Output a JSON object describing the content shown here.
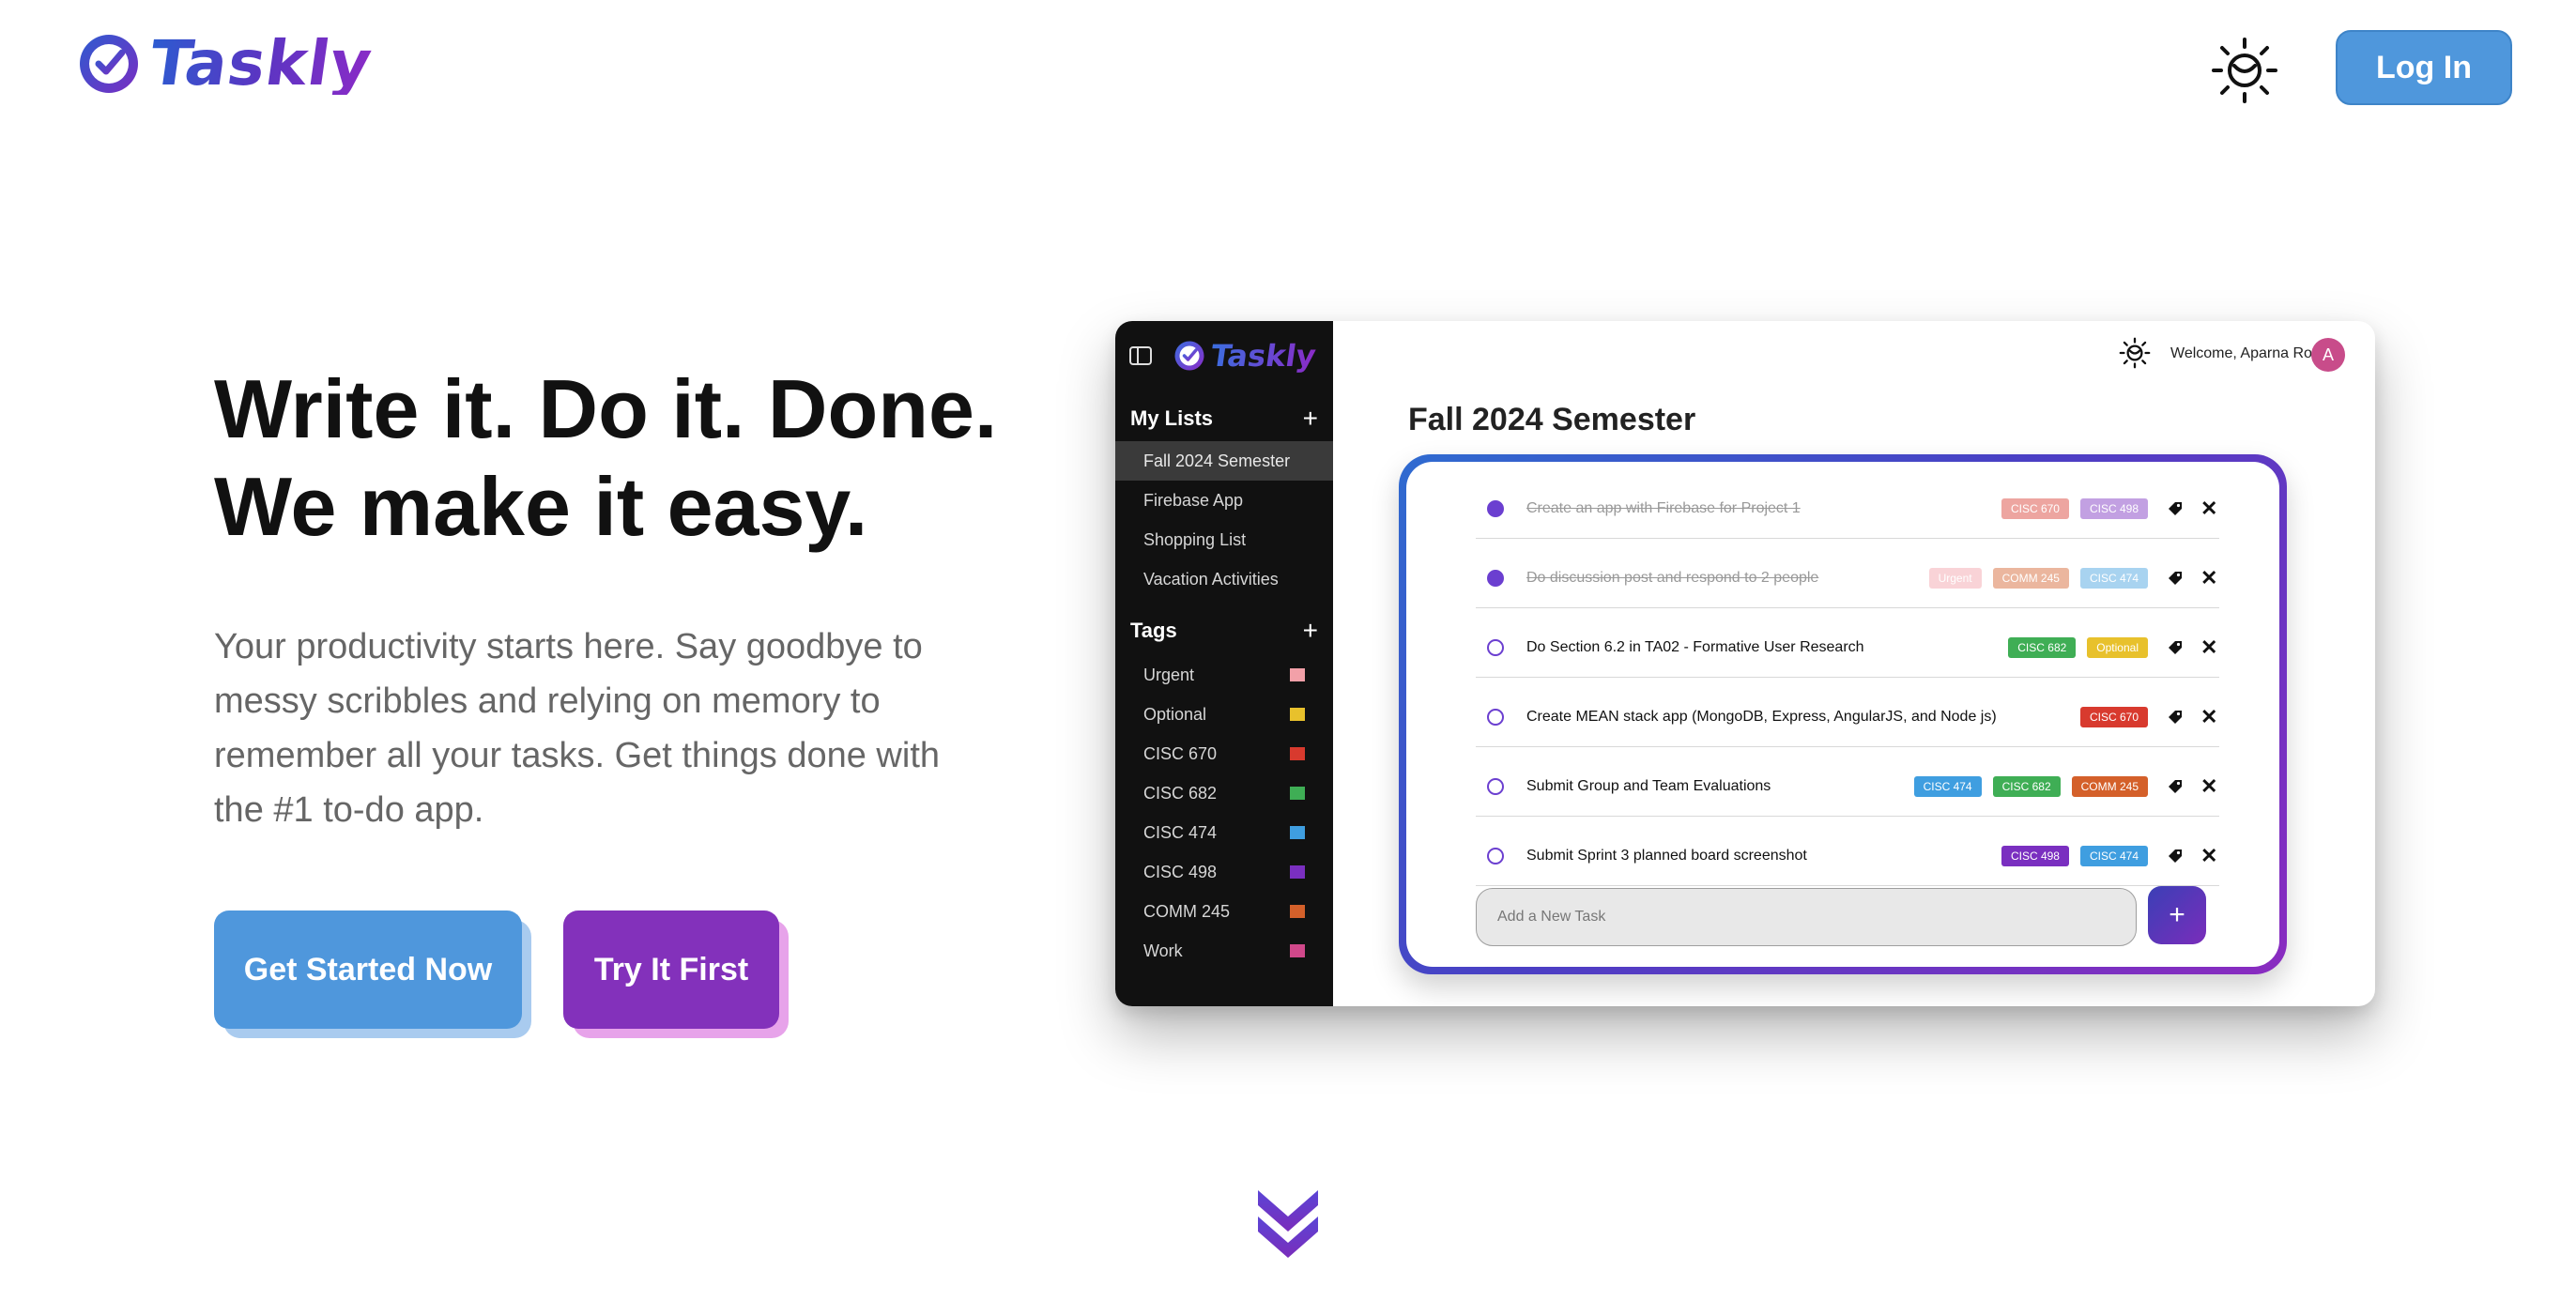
{
  "header": {
    "brand": "Taskly",
    "login_label": "Log In",
    "icons": {
      "logo": "check-circle-icon",
      "theme": "sun-icon"
    }
  },
  "hero": {
    "headline_line1": "Write it. Do it. Done.",
    "headline_line2": "We make it easy.",
    "subtext": "Your productivity starts here. Say goodbye to messy scribbles and relying on memory to remember all your tasks. Get things done with the #1 to-do app.",
    "cta_primary": "Get Started Now",
    "cta_secondary": "Try It First"
  },
  "colors": {
    "primary_blue": "#4f97dc",
    "accent_purple": "#8331bb",
    "brand_gradient": [
      "#2d5bd0",
      "#8a2bc7"
    ]
  },
  "mock": {
    "brand": "Taskly",
    "welcome": "Welcome, Aparna Roy",
    "avatar_initial": "A",
    "page_title": "Fall 2024 Semester",
    "my_lists_heading": "My Lists",
    "lists": [
      "Fall 2024 Semester",
      "Firebase App",
      "Shopping List",
      "Vacation Activities"
    ],
    "active_list": "Fall 2024 Semester",
    "tags_heading": "Tags",
    "tags": [
      {
        "name": "Urgent",
        "color": "#f2a0a8"
      },
      {
        "name": "Optional",
        "color": "#e8c12c"
      },
      {
        "name": "CISC 670",
        "color": "#d83a2e"
      },
      {
        "name": "CISC 682",
        "color": "#3fae55"
      },
      {
        "name": "CISC 474",
        "color": "#3f9ee0"
      },
      {
        "name": "CISC 498",
        "color": "#7a2fc0"
      },
      {
        "name": "COMM 245",
        "color": "#d4602a"
      },
      {
        "name": "Work",
        "color": "#d0488a"
      }
    ],
    "tasks": [
      {
        "text": "Create an app with Firebase for Project 1",
        "done": true,
        "tags": [
          "CISC 670",
          "CISC 498"
        ]
      },
      {
        "text": "Do discussion post and respond to 2 people",
        "done": true,
        "tags": [
          "Urgent",
          "COMM 245",
          "CISC 474"
        ]
      },
      {
        "text": "Do Section 6.2 in TA02 - Formative User Research",
        "done": false,
        "tags": [
          "CISC 682",
          "Optional"
        ]
      },
      {
        "text": "Create MEAN stack app (MongoDB, Express, AngularJS, and Node js)",
        "done": false,
        "tags": [
          "CISC 670"
        ]
      },
      {
        "text": "Submit Group and Team Evaluations",
        "done": false,
        "tags": [
          "CISC 474",
          "CISC 682",
          "COMM 245"
        ]
      },
      {
        "text": "Submit Sprint 3 planned board screenshot",
        "done": false,
        "tags": [
          "CISC 498",
          "CISC 474"
        ]
      }
    ],
    "new_task_placeholder": "Add a New Task",
    "add_button": "+"
  }
}
